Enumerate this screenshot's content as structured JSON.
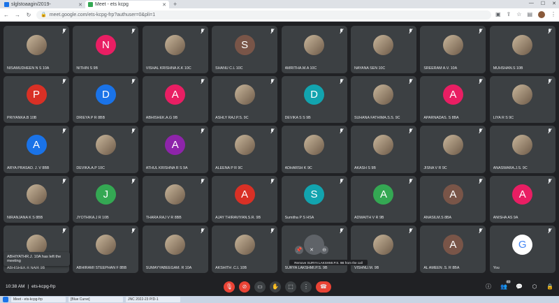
{
  "browser": {
    "tabs": [
      {
        "title": "slglstoaagin/2019-",
        "active": false
      },
      {
        "title": "Meet - ets kcpg",
        "active": true
      }
    ],
    "url": "meet.google.com/ets-kcpg-frp?authuser=0&pli=1"
  },
  "participants": [
    {
      "name": "NISAMUDHEEN N S 10A",
      "avatar": "photo",
      "color": ""
    },
    {
      "name": "NITHIN S 9B",
      "avatar": "letter",
      "letter": "N",
      "color": "#e91e63"
    },
    {
      "name": "VISHAL KRISHNA.K.K 10C",
      "avatar": "photo",
      "color": ""
    },
    {
      "name": "SHANU C.L 10C",
      "avatar": "letter",
      "letter": "S",
      "color": "#795548"
    },
    {
      "name": "AMRITHA.M.A 10C",
      "avatar": "photo",
      "color": ""
    },
    {
      "name": "NAYANA SEN 10C",
      "avatar": "photo",
      "color": ""
    },
    {
      "name": "SREERAM A.V. 10A",
      "avatar": "photo",
      "color": ""
    },
    {
      "name": "MUHSHAN.S 10B",
      "avatar": "photo",
      "color": ""
    },
    {
      "name": "PRIYANKA.B 10B",
      "avatar": "letter",
      "letter": "P",
      "color": "#d93025"
    },
    {
      "name": "DRIEYA P R 8BB",
      "avatar": "letter",
      "letter": "D",
      "color": "#1a73e8"
    },
    {
      "name": "ABHISHEK.A.G 9B",
      "avatar": "letter",
      "letter": "A",
      "color": "#e91e63"
    },
    {
      "name": "ASHLY RAJ.P.S. 9C",
      "avatar": "photo",
      "color": ""
    },
    {
      "name": "DEVIKA S S 9B",
      "avatar": "letter",
      "letter": "D",
      "color": "#12a4af"
    },
    {
      "name": "SUHANA FATHIMA.S.S. 9C",
      "avatar": "photo",
      "color": ""
    },
    {
      "name": "APARNADAS. S 8BA",
      "avatar": "letter",
      "letter": "A",
      "color": "#e91e63"
    },
    {
      "name": "LIYA R S 9C",
      "avatar": "photo",
      "color": ""
    },
    {
      "name": "ARYA PRASAD. J. V 8BB",
      "avatar": "letter",
      "letter": "A",
      "color": "#1a73e8"
    },
    {
      "name": "DEVIKA.A.P 10C",
      "avatar": "photo",
      "color": ""
    },
    {
      "name": "ATHUL KRISHNA R S 9A",
      "avatar": "letter",
      "letter": "A",
      "color": "#8e24aa"
    },
    {
      "name": "ALEENA P R 9C",
      "avatar": "photo",
      "color": ""
    },
    {
      "name": "ADHARSH K 9C",
      "avatar": "photo",
      "color": ""
    },
    {
      "name": "AKASH S 9B",
      "avatar": "photo",
      "color": ""
    },
    {
      "name": "JISNA V R 9C",
      "avatar": "photo",
      "color": ""
    },
    {
      "name": "ANASWARA.J.S. 9C",
      "avatar": "photo",
      "color": ""
    },
    {
      "name": "NIRANJANA K S 8BB",
      "avatar": "photo",
      "color": ""
    },
    {
      "name": "JYOTHIKA.J R 10B",
      "avatar": "letter",
      "letter": "J",
      "color": "#34a853"
    },
    {
      "name": "THARA RAJ V R 8BB",
      "avatar": "photo",
      "color": ""
    },
    {
      "name": "AJAY THIRAVIYAN.S.R. 9B",
      "avatar": "letter",
      "letter": "A",
      "color": "#d93025"
    },
    {
      "name": "Sumitha P S HSA",
      "avatar": "letter",
      "letter": "S",
      "color": "#12a4af"
    },
    {
      "name": "ADWAITH V R 9B",
      "avatar": "letter",
      "letter": "A",
      "color": "#34a853"
    },
    {
      "name": "ANASILM.S 8BA",
      "avatar": "letter",
      "letter": "A",
      "color": "#795548"
    },
    {
      "name": "ANISHA AS 9A",
      "avatar": "letter",
      "letter": "A",
      "color": "#e91e63"
    },
    {
      "name": "ABHISHEK R NAIR 9B",
      "avatar": "photo",
      "color": ""
    },
    {
      "name": "ABHIRAMI STEEPHAN F 8BB",
      "avatar": "photo",
      "color": ""
    },
    {
      "name": "SUMAYYABEEGAM. R 10A",
      "avatar": "photo",
      "color": ""
    },
    {
      "name": "AKSHITH .C.L 10B",
      "avatar": "photo",
      "color": ""
    },
    {
      "name": "SURYA LAKSHMI.P.S. 9B",
      "avatar": "letter",
      "letter": "",
      "color": "#5f6368"
    },
    {
      "name": "VISHNU.M. 9B",
      "avatar": "photo",
      "color": ""
    },
    {
      "name": "AL AMEEN .S. R 8BA",
      "avatar": "letter",
      "letter": "A",
      "color": "#795548"
    },
    {
      "name": "You",
      "avatar": "letter",
      "letter": "G",
      "color": "#ffffff"
    }
  ],
  "toast": "ABHIYATHR.J. 10A has left the meeting",
  "hover_tip": "Remove SURYA LAKSHMI.P.S. 9B from the call",
  "meeting": {
    "time": "10:38 AM",
    "separator": "|",
    "code": "ets-kcpg-frp"
  },
  "participant_count": "40",
  "taskbar": [
    {
      "title": "Meet - ets-kcpg-frp"
    },
    {
      "title": "[Blue Curve]"
    },
    {
      "title": "JNC 2022-23 P/D-1"
    }
  ]
}
